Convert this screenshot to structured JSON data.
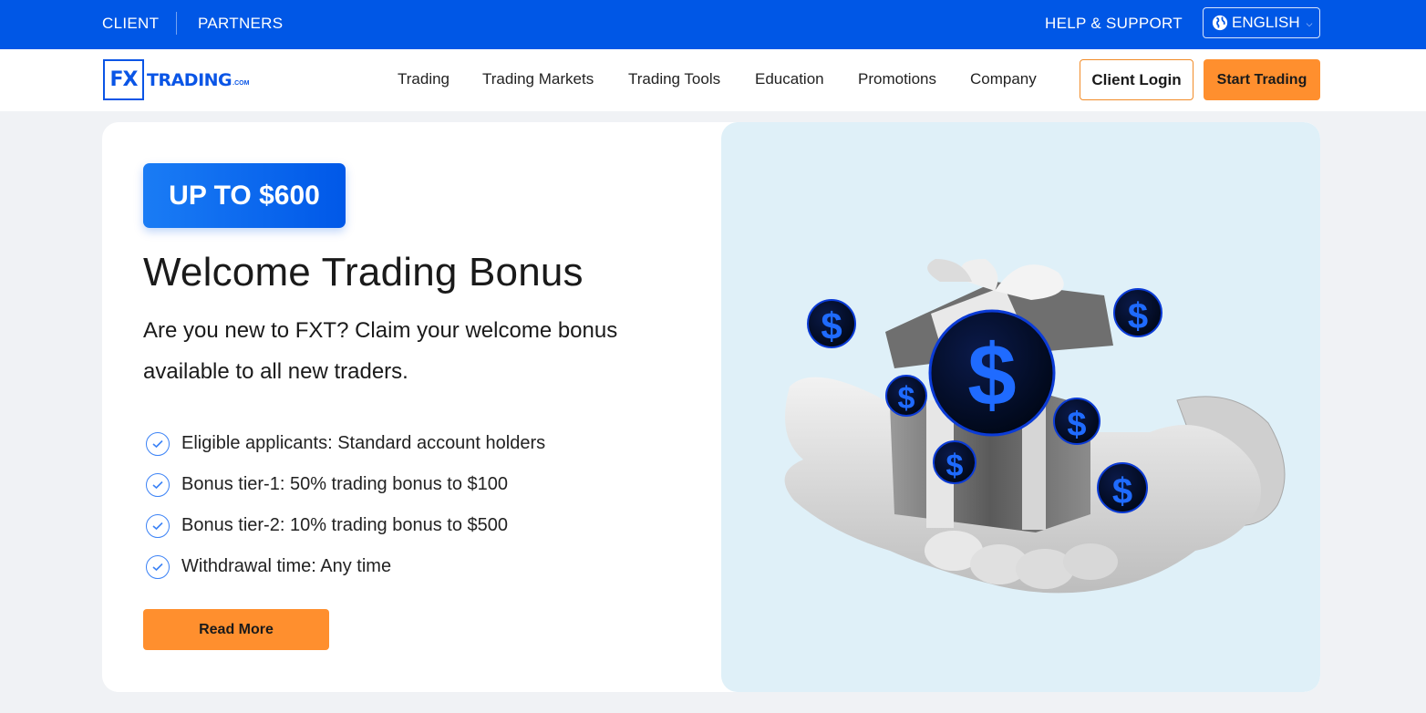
{
  "topbar": {
    "links": [
      "CLIENT",
      "PARTNERS"
    ],
    "help": "HELP & SUPPORT",
    "language": "ENGLISH"
  },
  "navbar": {
    "logo": {
      "mark": "FX",
      "text": "TRADING",
      "suffix": ".COM"
    },
    "items": [
      "Trading",
      "Trading Markets",
      "Trading Tools",
      "Education",
      "Promotions",
      "Company"
    ],
    "login_label": "Client Login",
    "start_label": "Start Trading"
  },
  "promo": {
    "badge": "UP TO $600",
    "title": "Welcome Trading Bonus",
    "intro": "Are you new to FXT? Claim your welcome bonus available to all new traders.",
    "features": [
      "Eligible applicants: Standard account holders",
      "Bonus tier-1: 50% trading bonus to $100",
      "Bonus tier-2: 10% trading bonus to $500",
      "Withdrawal time: Any time"
    ],
    "cta_label": "Read More",
    "illustration": "hand-holding-open-gift-box-with-dollar-coins"
  },
  "colors": {
    "topbar": "#0057e6",
    "accent": "#ff8f2e",
    "brand_blue": "#0a55e6",
    "illustration_bg": "#dff0f8"
  }
}
